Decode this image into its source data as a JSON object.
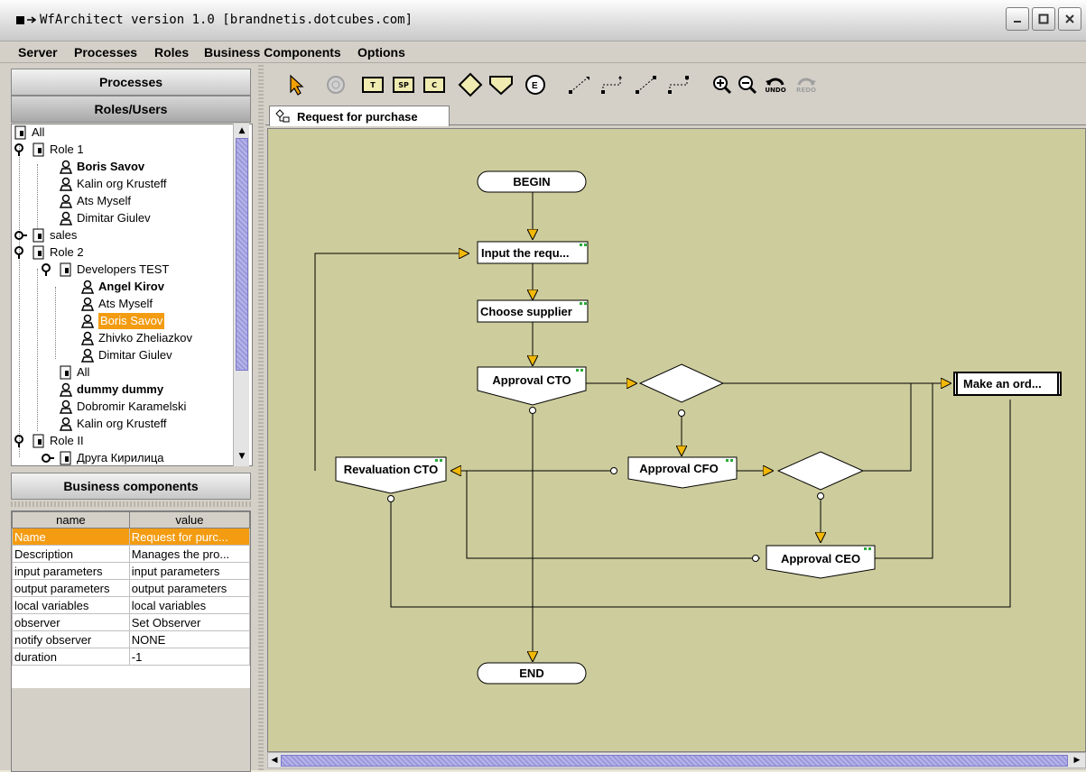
{
  "window": {
    "title": "WfArchitect version 1.0 [brandnetis.dotcubes.com]"
  },
  "menu": [
    "Server",
    "Processes",
    "Roles",
    "Business Components",
    "Options"
  ],
  "left": {
    "processes_label": "Processes",
    "roles_label": "Roles/Users",
    "bc_label": "Business components"
  },
  "tree": [
    {
      "label": "All",
      "type": "group"
    },
    {
      "label": "Role 1",
      "type": "group"
    },
    {
      "label": "Boris Savov",
      "type": "user",
      "bold": true
    },
    {
      "label": "Kalin org Krusteff",
      "type": "user"
    },
    {
      "label": "Ats Myself",
      "type": "user"
    },
    {
      "label": "Dimitar Giulev",
      "type": "user"
    },
    {
      "label": "sales",
      "type": "group"
    },
    {
      "label": "Role 2",
      "type": "group"
    },
    {
      "label": "Developers TEST",
      "type": "group"
    },
    {
      "label": "Angel Kirov",
      "type": "user",
      "bold": true
    },
    {
      "label": "Ats Myself",
      "type": "user"
    },
    {
      "label": "Boris Savov",
      "type": "user",
      "selected": true
    },
    {
      "label": "Zhivko Zheliazkov",
      "type": "user"
    },
    {
      "label": "Dimitar Giulev",
      "type": "user"
    },
    {
      "label": "All",
      "type": "group"
    },
    {
      "label": "dummy dummy",
      "type": "user",
      "bold": true
    },
    {
      "label": "Dobromir Karamelski",
      "type": "user"
    },
    {
      "label": "Kalin org Krusteff",
      "type": "user"
    },
    {
      "label": "Role II",
      "type": "group"
    },
    {
      "label": "Друга Кирилица",
      "type": "group"
    }
  ],
  "props": {
    "headers": [
      "name",
      "value"
    ],
    "rows": [
      [
        "Name",
        "Request for purc..."
      ],
      [
        "Description",
        "Manages the pro..."
      ],
      [
        "input parameters",
        "input parameters"
      ],
      [
        "output parameters",
        "output parameters"
      ],
      [
        "local variables",
        "local variables"
      ],
      [
        "observer",
        "Set Observer"
      ],
      [
        "notify observer",
        "NONE"
      ],
      [
        "duration",
        "-1"
      ]
    ]
  },
  "toolbar": {
    "tools": [
      "select-arrow-icon",
      "disabled-circle-icon",
      "task-T-icon",
      "subprocess-SP-icon",
      "component-C-icon",
      "decision-diamond-icon",
      "merge-triangle-icon",
      "event-circle-icon",
      "line-tool-icon",
      "elbow-line-tool-icon",
      "line-tool-2-icon",
      "elbow-line-tool-2-icon",
      "zoom-in-icon",
      "zoom-out-icon",
      "undo-icon",
      "redo-icon"
    ],
    "box_T": "T",
    "box_SP": "SP",
    "box_C": "C",
    "undo_label": "UNDO",
    "redo_label": "REDO"
  },
  "tab": {
    "label": "Request for purchase"
  },
  "diagram": {
    "begin": "BEGIN",
    "end": "END",
    "input": "Input the requ...",
    "choose": "Choose supplier",
    "approval_cto": "Approval CTO",
    "approval_cfo": "Approval CFO",
    "approval_ceo": "Approval CEO",
    "revaluation_cto": "Revaluation CTO",
    "make_order": "Make an ord..."
  },
  "colors": {
    "canvas": "#CDCC9C",
    "arrow": "#F2B807",
    "selection": "#F39C12",
    "scroll_thumb": "#9C98DC"
  }
}
